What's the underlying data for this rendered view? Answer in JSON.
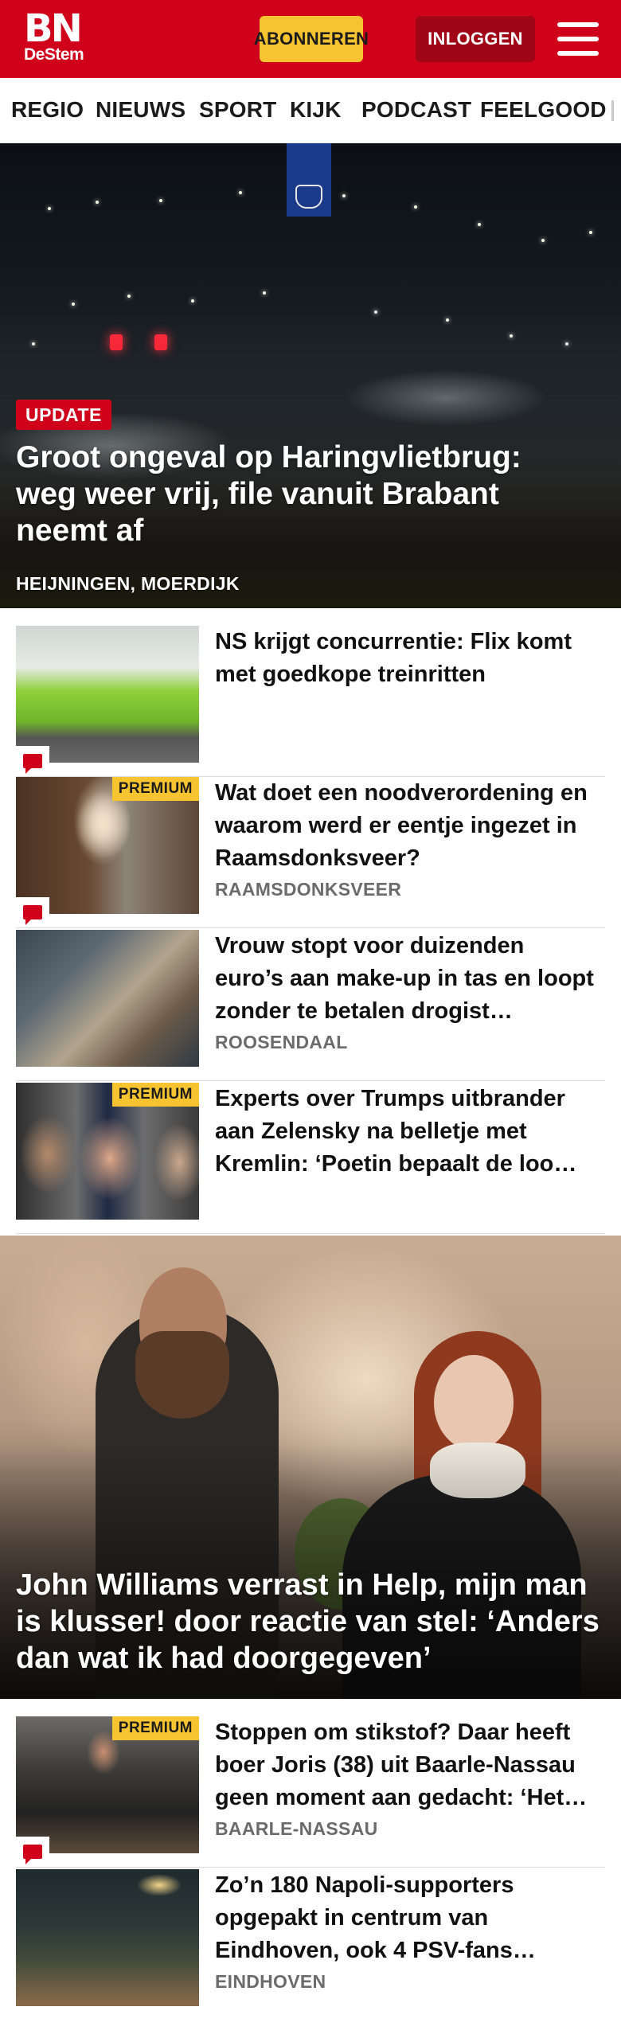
{
  "header": {
    "logo_main": "BN",
    "logo_sub": "DeStem",
    "subscribe_label": "ABONNEREN",
    "login_label": "INLOGGEN",
    "menu_icon": "hamburger-menu-icon",
    "brand_color": "#d0021b",
    "accent_color": "#f7c431"
  },
  "nav": {
    "items": [
      "REGIO",
      "NIEUWS",
      "SPORT",
      "KIJK",
      "PODCAST",
      "FEELGOOD"
    ]
  },
  "hero": {
    "tag": "UPDATE",
    "title": "Groot ongeval op Haringvlietbrug: weg weer vrij, file vanuit Brabant neemt af",
    "location": "HEIJNINGEN, MOERDIJK"
  },
  "articles": [
    {
      "title": "NS krijgt concurrentie: Flix komt met goedkope treinritten",
      "location": "",
      "premium": "",
      "comment_icon": "comment-icon"
    },
    {
      "title": "Wat doet een noodverordening en waarom werd er eentje ingezet in Raamsdonksveer?",
      "location": "RAAMSDONKSVEER",
      "premium": "PREMIUM",
      "comment_icon": "comment-icon"
    },
    {
      "title": "Vrouw stopt voor duizenden euro’s aan make-up in tas en loopt zonder te betalen drogist…",
      "location": "ROOSENDAAL",
      "premium": "",
      "comment_icon": ""
    },
    {
      "title": "Experts over Trumps uitbrander aan Zelensky na belletje met Kremlin: ‘Poetin bepaalt de loo…",
      "location": "",
      "premium": "PREMIUM",
      "comment_icon": ""
    }
  ],
  "feature": {
    "title": "John Williams verrast in Help, mijn man is klusser! door reactie van stel: ‘Anders dan wat ik had doorgegeven’"
  },
  "articles_bottom": [
    {
      "title": "Stoppen om stikstof? Daar heeft boer Joris (38) uit Baarle-Nassau geen moment aan gedacht: ‘Het…",
      "location": "BAARLE-NASSAU",
      "premium": "PREMIUM",
      "comment_icon": "comment-icon"
    },
    {
      "title": "Zo’n 180 Napoli-supporters opgepakt in centrum van Eindhoven, ook 4 PSV-fans…",
      "location": "EINDHOVEN",
      "premium": "",
      "comment_icon": ""
    }
  ]
}
